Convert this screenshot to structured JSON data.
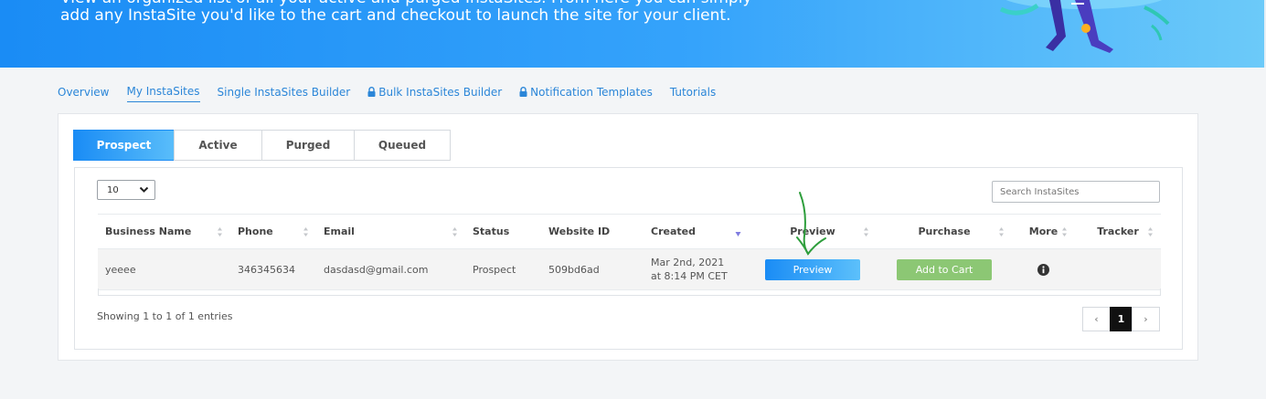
{
  "hero": {
    "line1": "View an organized list of all your active and purged InstaSites. From here you can simply",
    "line2": "add any InstaSite you'd like to the cart and checkout to launch the site for your client."
  },
  "nav": {
    "tabs": [
      {
        "label": "Overview",
        "locked": false,
        "active": false
      },
      {
        "label": "My InstaSites",
        "locked": false,
        "active": true
      },
      {
        "label": "Single InstaSites Builder",
        "locked": false,
        "active": false
      },
      {
        "label": "Bulk InstaSites Builder",
        "locked": true,
        "active": false
      },
      {
        "label": "Notification Templates",
        "locked": true,
        "active": false
      },
      {
        "label": "Tutorials",
        "locked": false,
        "active": false
      }
    ]
  },
  "status_tabs": [
    {
      "label": "Prospect",
      "active": true
    },
    {
      "label": "Active",
      "active": false
    },
    {
      "label": "Purged",
      "active": false
    },
    {
      "label": "Queued",
      "active": false
    }
  ],
  "table": {
    "page_length": "10",
    "search_placeholder": "Search InstaSites",
    "columns": [
      "Business Name",
      "Phone",
      "Email",
      "Status",
      "Website ID",
      "Created",
      "Preview",
      "Purchase",
      "More",
      "Tracker"
    ],
    "rows": [
      {
        "business_name": "yeeee",
        "phone": "346345634",
        "email": "dasdasd@gmail.com",
        "status": "Prospect",
        "website_id": "509bd6ad",
        "created_line1": "Mar 2nd, 2021",
        "created_line2": "at 8:14 PM CET",
        "preview_label": "Preview",
        "purchase_label": "Add to Cart",
        "more_icon": "info-icon",
        "tracker": ""
      }
    ],
    "info": "Showing 1 to 1 of 1 entries",
    "pagination": {
      "prev": "‹",
      "current": "1",
      "next": "›"
    }
  },
  "colors": {
    "accent": "#1a8cf5",
    "add_to_cart": "#8cc774",
    "annotation_arrow": "#2e9e3c"
  }
}
